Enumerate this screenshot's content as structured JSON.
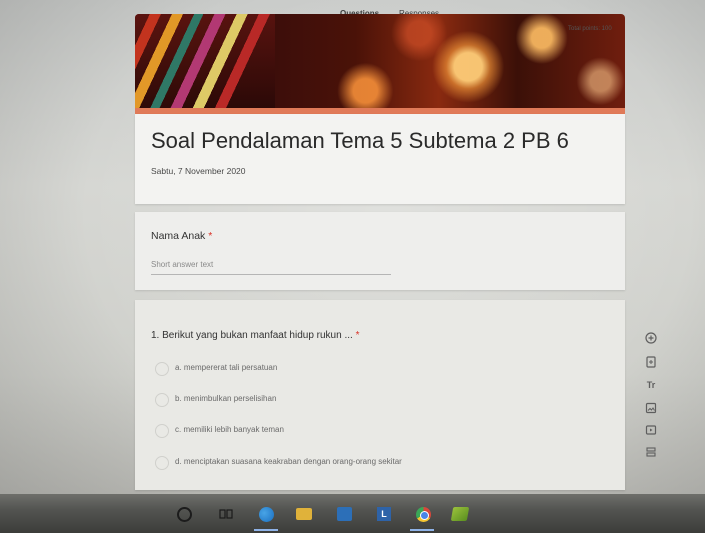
{
  "tabs": {
    "questions_label": "Questions",
    "responses_label": "Responses",
    "total_points": "Total points: 100"
  },
  "form": {
    "title": "Soal Pendalaman Tema 5 Subtema 2 PB 6",
    "date": "Sabtu, 7 November 2020"
  },
  "name_question": {
    "label": "Nama Anak",
    "required_mark": "*",
    "placeholder": "Short answer text"
  },
  "question1": {
    "text": "1. Berikut yang bukan manfaat hidup rukun ...",
    "required_mark": "*",
    "options": [
      "a. mempererat tali persatuan",
      "b. menimbulkan perselisihan",
      "c. memiliki lebih banyak teman",
      "d. menciptakan suasana keakraban dengan orang-orang sekitar"
    ]
  },
  "toolbar": {
    "icons": [
      "add-question-icon",
      "import-questions-icon",
      "add-title-icon",
      "add-image-icon",
      "add-video-icon",
      "add-section-icon"
    ],
    "text_icon_label": "Tr"
  },
  "taskbar": {
    "icons": [
      "search-icon",
      "task-view-icon",
      "edge-icon",
      "file-explorer-icon",
      "store-icon",
      "app-l-icon",
      "chrome-icon",
      "app-leaf-icon"
    ],
    "lib_label": "L"
  },
  "colors": {
    "accent": "#e07a58",
    "tab_active": "#5b3f86",
    "required": "#d93025"
  }
}
